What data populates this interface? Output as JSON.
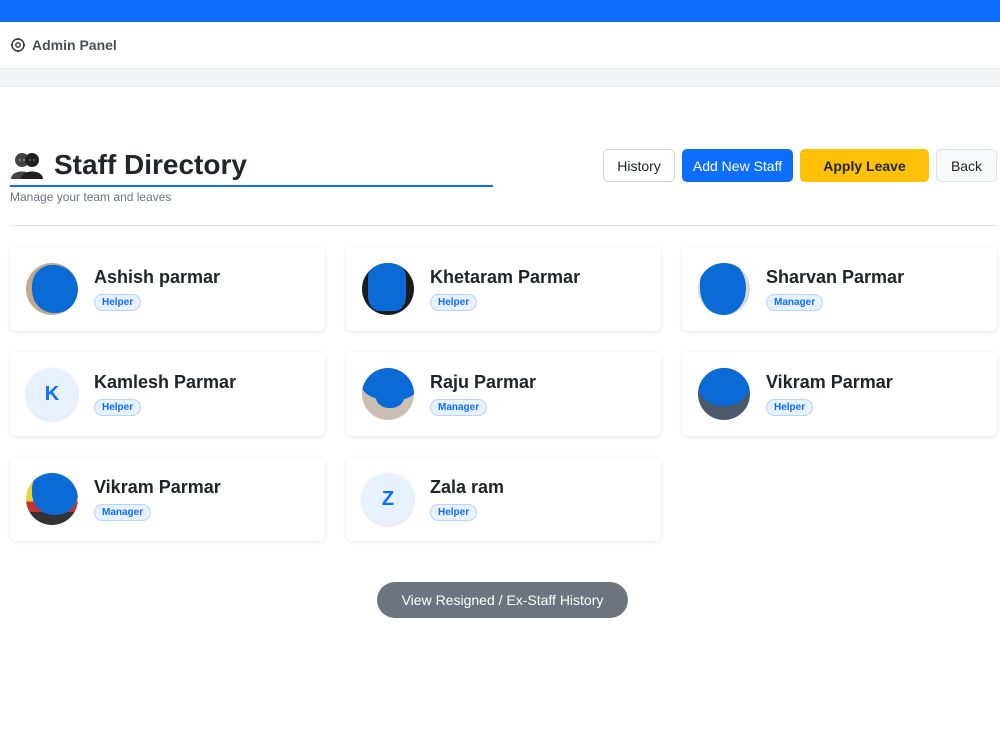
{
  "nav": {
    "brand": "Admin Panel",
    "brand_icon": "gear-icon"
  },
  "header": {
    "title": "Staff Directory",
    "title_icon": "people-icon",
    "subtitle": "Manage your team and leaves",
    "buttons": {
      "history": "History",
      "add_staff": "Add New Staff",
      "apply_leave": "Apply Leave",
      "back": "Back"
    }
  },
  "staff": [
    {
      "name": "Ashish parmar",
      "role": "Helper",
      "avatar": "photo"
    },
    {
      "name": "Khetaram Parmar",
      "role": "Helper",
      "avatar": "photo"
    },
    {
      "name": "Sharvan Parmar",
      "role": "Manager",
      "avatar": "photo"
    },
    {
      "name": "Kamlesh Parmar",
      "role": "Helper",
      "avatar": "K"
    },
    {
      "name": "Raju Parmar",
      "role": "Manager",
      "avatar": "photo"
    },
    {
      "name": "Vikram Parmar",
      "role": "Helper",
      "avatar": "photo"
    },
    {
      "name": "Vikram Parmar",
      "role": "Manager",
      "avatar": "photo"
    },
    {
      "name": "Zala ram",
      "role": "Helper",
      "avatar": "Z"
    }
  ],
  "footer": {
    "history_button": "View Resigned / Ex-Staff History"
  },
  "colors": {
    "primary": "#0d6efd",
    "warning": "#ffc107",
    "secondary": "#6c757d"
  }
}
